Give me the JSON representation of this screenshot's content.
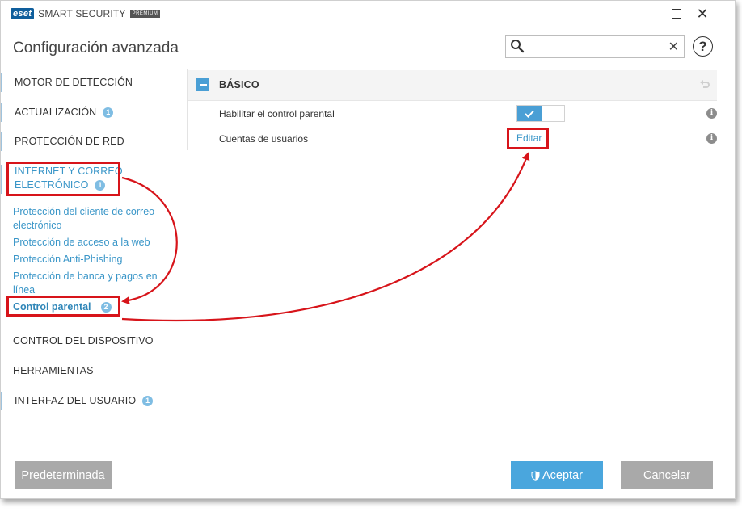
{
  "app": {
    "logo_brand": "eset",
    "product_name": "SMART SECURITY",
    "edition": "PREMIUM"
  },
  "header": {
    "title": "Configuración avanzada",
    "search": {
      "value": "",
      "placeholder": ""
    },
    "help_label": "?"
  },
  "sidebar": {
    "items": [
      {
        "label": "MOTOR DE DETECCIÓN",
        "badge": ""
      },
      {
        "label": "ACTUALIZACIÓN",
        "badge": "1"
      },
      {
        "label": "PROTECCIÓN DE RED",
        "badge": ""
      },
      {
        "label_line1": "INTERNET Y CORREO",
        "label_line2": "ELECTRÓNICO",
        "badge": "1"
      },
      {
        "label": "CONTROL DEL DISPOSITIVO",
        "badge": ""
      },
      {
        "label": "HERRAMIENTAS",
        "badge": ""
      },
      {
        "label": "INTERFAZ DEL USUARIO",
        "badge": "1"
      }
    ],
    "sub_items": [
      {
        "label_line1": "Protección del cliente de correo",
        "label_line2": "electrónico"
      },
      {
        "label": "Protección de acceso a la web"
      },
      {
        "label": "Protección Anti-Phishing"
      },
      {
        "label_line1": "Protección de banca y pagos en",
        "label_line2": "línea"
      },
      {
        "label": "Control parental",
        "badge": "2",
        "active": true
      }
    ]
  },
  "main": {
    "section_title": "BÁSICO",
    "rows": [
      {
        "label": "Habilitar el control parental",
        "control": "toggle",
        "enabled": true
      },
      {
        "label": "Cuentas de usuarios",
        "control": "link",
        "link_label": "Editar"
      }
    ],
    "info_glyph": "i"
  },
  "footer": {
    "default_label": "Predeterminada",
    "ok_label": "Aceptar",
    "cancel_label": "Cancelar"
  },
  "colors": {
    "accent": "#4aa6dd",
    "highlight": "#d7141a",
    "link": "#3a96c8",
    "badge": "#7fbde3"
  }
}
